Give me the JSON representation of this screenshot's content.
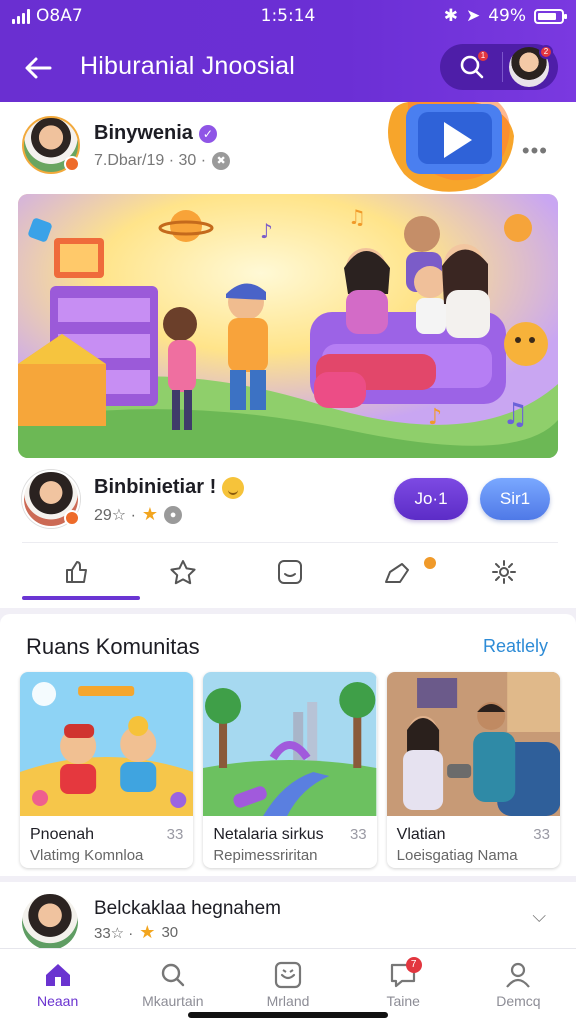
{
  "status": {
    "carrier": "O8A7",
    "time": "1:5:14",
    "battery": "49%"
  },
  "header": {
    "title": "Hiburanial Jnoosial",
    "search_badge": "1",
    "profile_badge": "2"
  },
  "post": {
    "author": "Binywenia",
    "meta": "7.Dbar/19 · 30 ·",
    "creator_name": "Binbinietiar !",
    "creator_meta": "29☆ ·",
    "join_label": "Jo·1",
    "start_label": "Sir1"
  },
  "community": {
    "title": "Ruans Komunitas",
    "see_all": "Reatlely",
    "tiles": [
      {
        "title": "Pnoenah",
        "sub": "Vlatimg Komnloa",
        "count": "33"
      },
      {
        "title": "Netalaria sirkus",
        "sub": "Repimessriritan",
        "count": "33"
      },
      {
        "title": "Vlatian",
        "sub": "Loeisgatiag Nama",
        "count": "33"
      }
    ]
  },
  "post2": {
    "name": "Belckaklaa hegnahem",
    "meta": "33☆ ·",
    "count": "30"
  },
  "nav": [
    {
      "label": "Neaan",
      "icon": "home-icon"
    },
    {
      "label": "Mkaurtain",
      "icon": "search-icon"
    },
    {
      "label": "Mrland",
      "icon": "media-icon"
    },
    {
      "label": "Taine",
      "icon": "chat-icon"
    },
    {
      "label": "Demcq",
      "icon": "profile-icon"
    }
  ],
  "nav_badge": "7",
  "colors": {
    "brand": "#6a2fd1",
    "accent_blue": "#4f79e7",
    "link": "#2d8bd6"
  }
}
